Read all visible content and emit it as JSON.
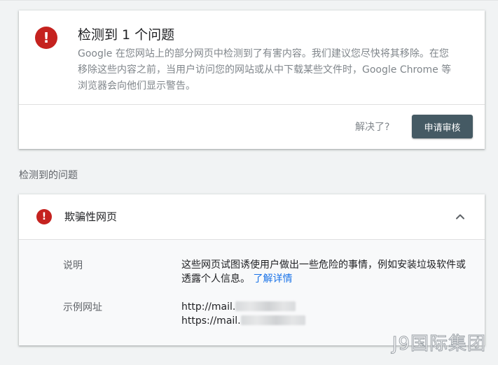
{
  "issue_card": {
    "icon": "alert-error-icon",
    "icon_glyph": "!",
    "title": "检测到 1 个问题",
    "description": "Google 在您网站上的部分网页中检测到了有害内容。我们建议您尽快将其移除。在您移除这些内容之前，当用户访问您的网站或从中下载某些文件时，Google Chrome 等浏览器会向他们显示警告。",
    "resolved_prompt": "解决了?",
    "review_button": "申请审核"
  },
  "section_heading": "检测到的问题",
  "problem_card": {
    "icon": "alert-error-icon",
    "icon_glyph": "!",
    "title": "欺骗性网页",
    "collapse_icon": "chevron-up-icon",
    "description_label": "说明",
    "description_text": "这些网页试图诱使用户做出一些危险的事情，例如安装垃圾软件或透露个人信息。",
    "learn_more_link": "了解详情",
    "example_urls_label": "示例网址",
    "example_urls": [
      "http://mail.",
      "https://mail."
    ]
  },
  "watermark": "J9国际集团",
  "colors": {
    "error_red": "#c5221f",
    "button_bg": "#455a64",
    "link_blue": "#1a73e8",
    "page_bg": "#f1f3f4"
  }
}
